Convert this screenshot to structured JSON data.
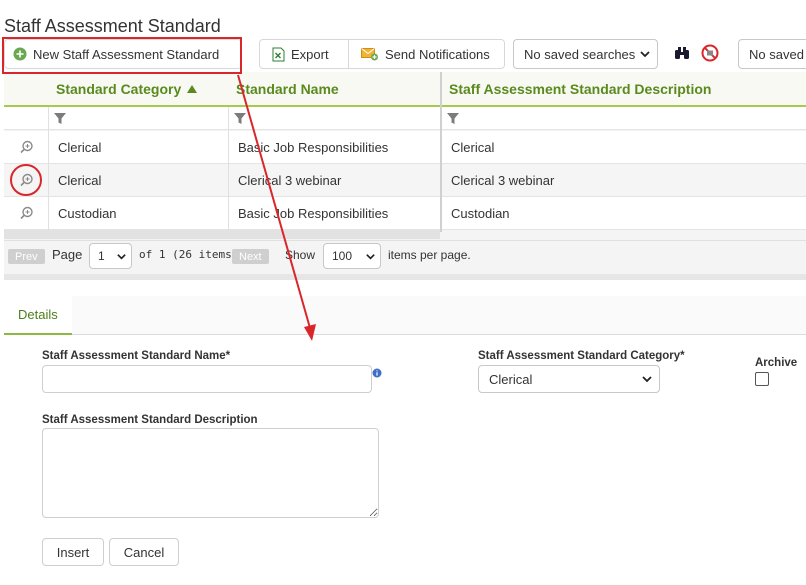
{
  "page": {
    "title": "Staff Assessment Standard"
  },
  "toolbar": {
    "new_label": "New Staff Assessment Standard",
    "export_label": "Export",
    "notify_label": "Send Notifications",
    "saved_searches": "No saved searches",
    "saved_searches_2": "No saved"
  },
  "grid": {
    "columns": [
      "Standard Category",
      "Standard Name",
      "Staff Assessment Standard Description"
    ],
    "rows": [
      {
        "category": "Clerical",
        "name": "Basic Job Responsibilities",
        "description": "Clerical"
      },
      {
        "category": "Clerical",
        "name": "Clerical 3 webinar",
        "description": "Clerical 3 webinar"
      },
      {
        "category": "Custodian",
        "name": "Basic Job Responsibilities",
        "description": "Custodian"
      }
    ]
  },
  "pager": {
    "prev": "Prev",
    "page_label": "Page",
    "page_value": "1",
    "of_label": "of 1 (26 items)",
    "next": "Next",
    "show_label": "Show",
    "per_page": "100",
    "per_page_label": "items per page."
  },
  "details": {
    "tab_label": "Details",
    "name_label": "Staff Assessment Standard Name*",
    "name_value": "",
    "category_label": "Staff Assessment Standard Category*",
    "category_value": "Clerical",
    "archive_label": "Archive",
    "description_label": "Staff Assessment Standard Description",
    "description_value": "",
    "insert_label": "Insert",
    "cancel_label": "Cancel"
  },
  "colors": {
    "accent": "#5a8a1e",
    "header_rule": "#a7c94f",
    "annotation": "#d9262b"
  },
  "icons": [
    "plus-circle-icon",
    "excel-icon",
    "envelope-plus-icon",
    "chevron-down-icon",
    "binoculars-icon",
    "no-icon",
    "filter-icon",
    "magnify-icon",
    "info-icon",
    "sort-asc-icon"
  ]
}
